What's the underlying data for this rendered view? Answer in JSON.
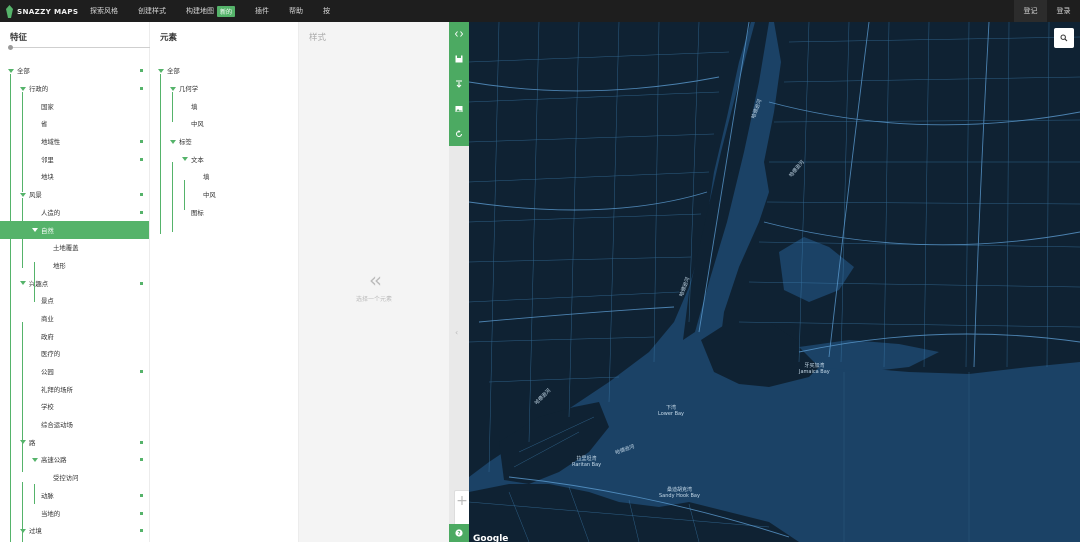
{
  "brand": {
    "name": "SNAZZY MAPS"
  },
  "nav": {
    "items": [
      "探索风格",
      "创建样式",
      "构建地图",
      "插件",
      "帮助",
      "按"
    ],
    "badge": "新的",
    "login": "登记",
    "signup": "登录"
  },
  "panels": {
    "features_title": "特征",
    "elements_title": "元素",
    "styles_title": "样式",
    "styles_hint": "选择一个元素"
  },
  "features": [
    {
      "label": "全部",
      "level": 0,
      "caret": true,
      "dot": true
    },
    {
      "label": "行政的",
      "level": 1,
      "caret": true,
      "dot": true
    },
    {
      "label": "国家",
      "level": 2,
      "caret": false,
      "dot": false
    },
    {
      "label": "省",
      "level": 2,
      "caret": false,
      "dot": false
    },
    {
      "label": "地域性",
      "level": 2,
      "caret": false,
      "dot": true
    },
    {
      "label": "邻里",
      "level": 2,
      "caret": false,
      "dot": true
    },
    {
      "label": "地块",
      "level": 2,
      "caret": false,
      "dot": false
    },
    {
      "label": "风景",
      "level": 1,
      "caret": true,
      "dot": true
    },
    {
      "label": "人造的",
      "level": 2,
      "caret": false,
      "dot": true
    },
    {
      "label": "自然",
      "level": 2,
      "caret": true,
      "dot": false,
      "selected": true
    },
    {
      "label": "土地覆盖",
      "level": 3,
      "caret": false,
      "dot": false
    },
    {
      "label": "地形",
      "level": 3,
      "caret": false,
      "dot": false
    },
    {
      "label": "兴趣点",
      "level": 1,
      "caret": true,
      "dot": true
    },
    {
      "label": "景点",
      "level": 2,
      "caret": false,
      "dot": false
    },
    {
      "label": "商业",
      "level": 2,
      "caret": false,
      "dot": false
    },
    {
      "label": "政府",
      "level": 2,
      "caret": false,
      "dot": false
    },
    {
      "label": "医疗的",
      "level": 2,
      "caret": false,
      "dot": false
    },
    {
      "label": "公园",
      "level": 2,
      "caret": false,
      "dot": true
    },
    {
      "label": "礼拜的场所",
      "level": 2,
      "caret": false,
      "dot": false
    },
    {
      "label": "学校",
      "level": 2,
      "caret": false,
      "dot": false
    },
    {
      "label": "综合运动场",
      "level": 2,
      "caret": false,
      "dot": false
    },
    {
      "label": "路",
      "level": 1,
      "caret": true,
      "dot": true
    },
    {
      "label": "高速公路",
      "level": 2,
      "caret": true,
      "dot": true
    },
    {
      "label": "受控访问",
      "level": 3,
      "caret": false,
      "dot": false
    },
    {
      "label": "动脉",
      "level": 2,
      "caret": false,
      "dot": true
    },
    {
      "label": "当地的",
      "level": 2,
      "caret": false,
      "dot": true
    },
    {
      "label": "过境",
      "level": 1,
      "caret": true,
      "dot": true
    }
  ],
  "elements": [
    {
      "label": "全部",
      "level": 0,
      "caret": true
    },
    {
      "label": "几何学",
      "level": 1,
      "caret": true
    },
    {
      "label": "填",
      "level": 2,
      "caret": false
    },
    {
      "label": "中风",
      "level": 2,
      "caret": false
    },
    {
      "label": "标签",
      "level": 1,
      "caret": true
    },
    {
      "label": "文本",
      "level": 2,
      "caret": true
    },
    {
      "label": "填",
      "level": 3,
      "caret": false
    },
    {
      "label": "中风",
      "level": 3,
      "caret": false
    },
    {
      "label": "图标",
      "level": 2,
      "caret": false
    }
  ],
  "map": {
    "labels": [
      {
        "text": "哈德逊河"
      },
      {
        "text": "哈德逊河"
      },
      {
        "text": "哈德逊河"
      },
      {
        "text": "哈德逊河"
      },
      {
        "text": "牙买加湾",
        "sub": "Jamaica Bay"
      },
      {
        "text": "下湾",
        "sub": "Lower Bay"
      },
      {
        "text": "拉里坦湾",
        "sub": "Raritan Bay"
      },
      {
        "text": "桑迪胡克湾",
        "sub": "Sandy Hook Bay"
      },
      {
        "text": "哈德逊河"
      }
    ],
    "attribution": "Google"
  },
  "colors": {
    "accent": "#55b36a",
    "map_water": "#1b4266",
    "map_land": "#0f2233",
    "map_road": "#3d7fb0"
  }
}
